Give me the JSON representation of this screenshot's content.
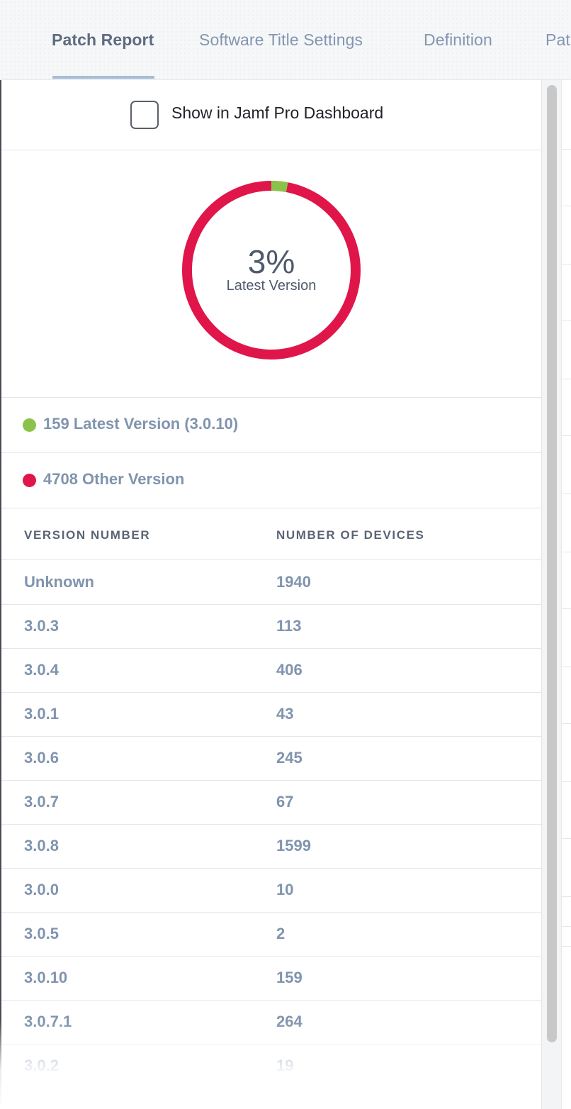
{
  "tabs": [
    {
      "label": "Patch Report",
      "active": true
    },
    {
      "label": "Software Title Settings",
      "active": false
    },
    {
      "label": "Definition",
      "active": false
    },
    {
      "label": "Pat",
      "active": false
    }
  ],
  "dashboard": {
    "checkbox_label": "Show in Jamf Pro Dashboard",
    "checked": false
  },
  "summary": {
    "percent_label": "3%",
    "caption": "Latest Version",
    "latest_fraction": 0.03,
    "colors": {
      "latest": "#8bc34a",
      "other": "#e0164a"
    }
  },
  "legend": [
    {
      "label": "159 Latest Version (3.0.10)",
      "color": "#8bc34a"
    },
    {
      "label": "4708 Other Version",
      "color": "#e0164a"
    }
  ],
  "table": {
    "headers": {
      "version": "VERSION NUMBER",
      "devices": "NUMBER OF DEVICES"
    },
    "rows": [
      {
        "version": "Unknown",
        "devices": "1940"
      },
      {
        "version": "3.0.3",
        "devices": "113"
      },
      {
        "version": "3.0.4",
        "devices": "406"
      },
      {
        "version": "3.0.1",
        "devices": "43"
      },
      {
        "version": "3.0.6",
        "devices": "245"
      },
      {
        "version": "3.0.7",
        "devices": "67"
      },
      {
        "version": "3.0.8",
        "devices": "1599"
      },
      {
        "version": "3.0.0",
        "devices": "10"
      },
      {
        "version": "3.0.5",
        "devices": "2"
      },
      {
        "version": "3.0.10",
        "devices": "159"
      },
      {
        "version": "3.0.7.1",
        "devices": "264"
      },
      {
        "version": "3.0.2",
        "devices": "19"
      }
    ]
  }
}
